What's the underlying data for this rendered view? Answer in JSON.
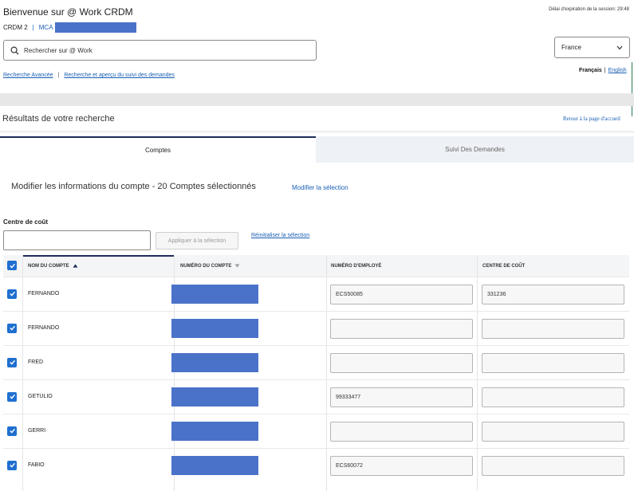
{
  "header": {
    "title": "Bienvenue sur @ Work CRDM",
    "session_expiry": "Délai d'expiration de la session: 29:48",
    "crumb_prefix": "CRDM 2",
    "crumb_sep": "|",
    "crumb_link": "MCA"
  },
  "search": {
    "placeholder": "Rechercher sur @ Work"
  },
  "country": {
    "selected": "France"
  },
  "links": {
    "advanced": "Recherche Avancée",
    "pipe": "|",
    "tracking": "Recherche et aperçu du suivi des demandes"
  },
  "language": {
    "fr": "Français",
    "pipe": "|",
    "en": "English"
  },
  "results": {
    "title": "Résultats de votre recherche",
    "back_home": "Retour à la page d'accueil"
  },
  "tabs": [
    {
      "label": "Comptes",
      "active": true
    },
    {
      "label": "Suivi Des Demandes",
      "active": false
    }
  ],
  "modify": {
    "title": "Modifier les informations du compte - 20 Comptes sélectionnés",
    "link": "Modifier la sélection"
  },
  "cost_center": {
    "label": "Centre de coût",
    "apply_label": "Appliquer à la sélection",
    "reset_label": "Réinitialiser la sélection"
  },
  "table": {
    "columns": [
      "NOM DU COMPTE",
      "NUMÉRO DU COMPTE",
      "NUMÉRO D'EMPLOYÉ",
      "CENTRE DE COÛT"
    ],
    "rows": [
      {
        "name": "FERNANDO",
        "employee": "ECS50085",
        "cost_center": "331236"
      },
      {
        "name": "FERNANDO",
        "employee": "",
        "cost_center": ""
      },
      {
        "name": "FRED",
        "employee": "",
        "cost_center": ""
      },
      {
        "name": "GETULIO",
        "employee": "99333477",
        "cost_center": ""
      },
      {
        "name": "GERRI",
        "employee": "",
        "cost_center": ""
      },
      {
        "name": "FABIO",
        "employee": "ECS60072",
        "cost_center": ""
      }
    ]
  },
  "colors": {
    "accent": "#1f6fd0",
    "link": "#1a5fb4",
    "tab_active_border": "#1f2c5c",
    "redaction": "#4a72c8"
  }
}
